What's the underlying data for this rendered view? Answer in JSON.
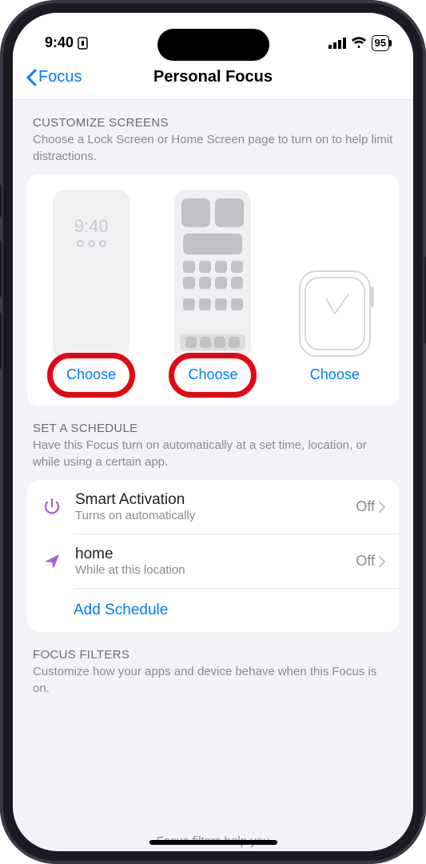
{
  "status": {
    "time": "9:40",
    "battery_pct": "95"
  },
  "nav": {
    "back_label": "Focus",
    "title": "Personal Focus"
  },
  "customize": {
    "header": "CUSTOMIZE SCREENS",
    "desc": "Choose a Lock Screen or Home Screen page to turn on to help limit distractions.",
    "lock_time": "9:40",
    "choose1": "Choose",
    "choose2": "Choose",
    "choose3": "Choose"
  },
  "schedule": {
    "header": "SET A SCHEDULE",
    "desc": "Have this Focus turn on automatically at a set time, location, or while using a certain app.",
    "items": [
      {
        "title": "Smart Activation",
        "sub": "Turns on automatically",
        "value": "Off"
      },
      {
        "title": "home",
        "sub": "While at this location",
        "value": "Off"
      }
    ],
    "add_label": "Add Schedule"
  },
  "filters": {
    "header": "FOCUS FILTERS",
    "desc": "Customize how your apps and device behave when this Focus is on.",
    "peek": "Focus filters help you"
  }
}
